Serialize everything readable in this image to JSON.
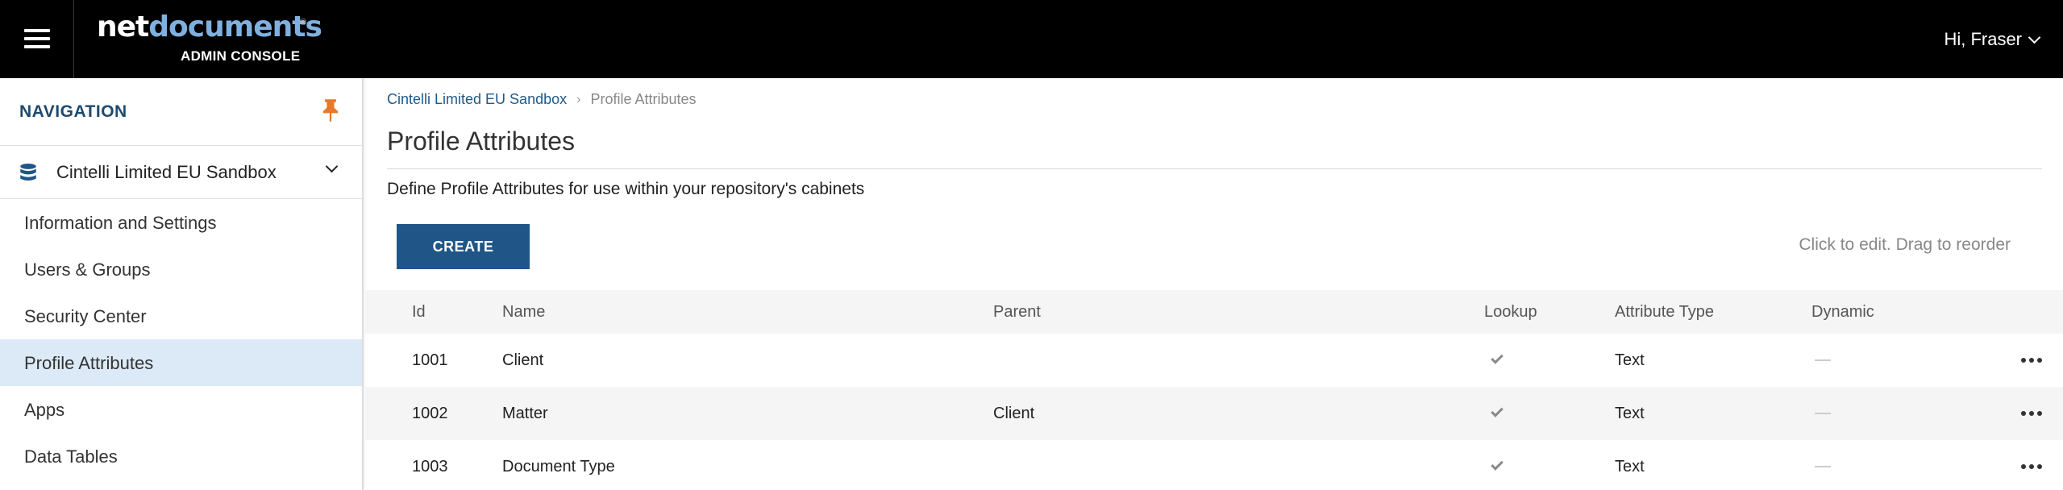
{
  "header": {
    "logo_part1": "net",
    "logo_part2": "documents",
    "logo_reg": "®",
    "logo_sub": "ADMIN CONSOLE",
    "user_greeting": "Hi, Fraser"
  },
  "sidebar": {
    "title": "NAVIGATION",
    "repository": "Cintelli Limited EU Sandbox",
    "items": [
      {
        "label": "Information and Settings"
      },
      {
        "label": "Users & Groups"
      },
      {
        "label": "Security Center"
      },
      {
        "label": "Profile Attributes"
      },
      {
        "label": "Apps"
      },
      {
        "label": "Data Tables"
      }
    ]
  },
  "main": {
    "breadcrumb": {
      "root": "Cintelli Limited EU Sandbox",
      "separator": "›",
      "current": "Profile Attributes"
    },
    "title": "Profile Attributes",
    "description": "Define Profile Attributes for use within your repository's cabinets",
    "create_label": "CREATE",
    "hint": "Click to edit. Drag to reorder",
    "table": {
      "headers": {
        "id": "Id",
        "name": "Name",
        "parent": "Parent",
        "lookup": "Lookup",
        "type": "Attribute Type",
        "dynamic": "Dynamic"
      },
      "rows": [
        {
          "id": "1001",
          "name": "Client",
          "parent": "",
          "lookup": true,
          "type": "Text",
          "dynamic": false
        },
        {
          "id": "1002",
          "name": "Matter",
          "parent": "Client",
          "lookup": true,
          "type": "Text",
          "dynamic": false
        },
        {
          "id": "1003",
          "name": "Document Type",
          "parent": "",
          "lookup": true,
          "type": "Text",
          "dynamic": false
        }
      ]
    }
  },
  "colors": {
    "topbar": "#000000",
    "accent": "#1f5587",
    "nav_title": "#1e4a6e",
    "pin": "#e8782a",
    "active_item": "#dce9f6"
  },
  "icons": [
    "hamburger-icon",
    "chevron-down-icon",
    "pin-icon",
    "database-icon",
    "check-icon",
    "more-horizontal-icon"
  ]
}
